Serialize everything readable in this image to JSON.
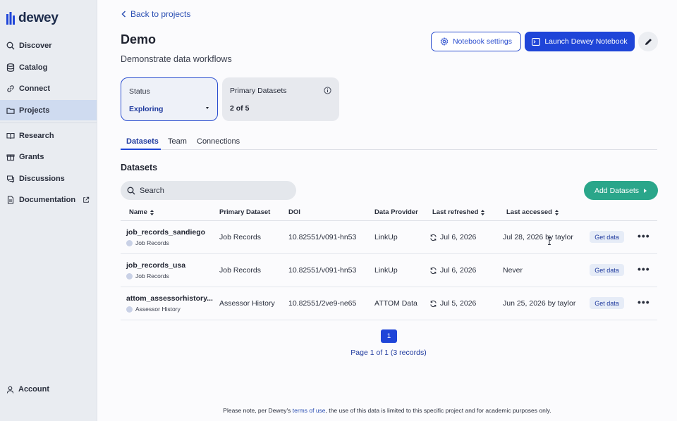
{
  "app": {
    "logo_text": "dewey"
  },
  "sidebar": {
    "items": [
      {
        "label": "Discover",
        "icon": "search-icon"
      },
      {
        "label": "Catalog",
        "icon": "database-icon"
      },
      {
        "label": "Connect",
        "icon": "link-icon"
      },
      {
        "label": "Projects",
        "icon": "folder-icon",
        "active": true
      },
      {
        "label": "Research",
        "icon": "book-icon"
      },
      {
        "label": "Grants",
        "icon": "gift-icon"
      },
      {
        "label": "Discussions",
        "icon": "chat-icon"
      },
      {
        "label": "Documentation",
        "icon": "document-icon"
      }
    ],
    "account_label": "Account"
  },
  "header": {
    "back_label": "Back to projects",
    "title": "Demo",
    "description": "Demonstrate data workflows",
    "notebook_settings_label": "Notebook settings",
    "launch_label": "Launch Dewey Notebook"
  },
  "cards": {
    "status_label": "Status",
    "status_value": "Exploring",
    "primary_label": "Primary Datasets",
    "primary_value": "2 of 5"
  },
  "tabs": [
    "Datasets",
    "Team",
    "Connections"
  ],
  "datasets": {
    "section_title": "Datasets",
    "search_placeholder": "Search",
    "add_label": "Add Datasets",
    "columns": [
      "Name",
      "Primary Dataset",
      "DOI",
      "Data Provider",
      "Last refreshed",
      "Last accessed"
    ],
    "rows": [
      {
        "name": "job_records_sandiego",
        "sub": "Job Records",
        "primary": "Job Records",
        "doi": "10.82551/v091-hn53",
        "provider": "LinkUp",
        "refreshed": "Jul 6, 2026",
        "accessed": "Jul 28, 2026 by taylor",
        "action": "Get data"
      },
      {
        "name": "job_records_usa",
        "sub": "Job Records",
        "primary": "Job Records",
        "doi": "10.82551/v091-hn53",
        "provider": "LinkUp",
        "refreshed": "Jul 6, 2026",
        "accessed": "Never",
        "action": "Get data"
      },
      {
        "name": "attom_assessorhistory...",
        "sub": "Assessor History",
        "primary": "Assessor History",
        "doi": "10.82551/2ve9-ne65",
        "provider": "ATTOM Data",
        "refreshed": "Jul 5, 2026",
        "accessed": "Jun 25, 2026 by taylor",
        "action": "Get data"
      }
    ]
  },
  "pagination": {
    "current": "1",
    "info": "Page 1 of 1 (3 records)"
  },
  "footer": {
    "prefix": "Please note, per Dewey's ",
    "link": "terms of use",
    "suffix": ", the use of this data is limited to this specific project and for academic purposes only."
  },
  "colors": {
    "accent": "#1f45d8",
    "add_button": "#2aa68a",
    "sidebar_bg": "#e9ecf1"
  }
}
